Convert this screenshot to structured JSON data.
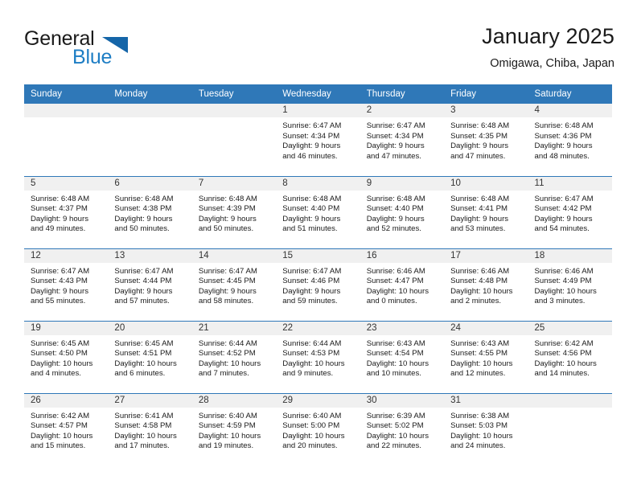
{
  "brand": {
    "name_part1": "General",
    "name_part2": "Blue",
    "logo_icon": "triangle-flag-icon",
    "accent_color": "#1d7dc4",
    "logo_triangle_color": "#1565a8"
  },
  "header": {
    "title": "January 2025",
    "subtitle": "Omigawa, Chiba, Japan"
  },
  "theme": {
    "header_band_color": "#2f78b8",
    "daynum_band_color": "#f0f0f0",
    "row_divider_color": "#2f78b8",
    "page_background": "#ffffff",
    "text_color": "#1a1a1a"
  },
  "weekdays": [
    "Sunday",
    "Monday",
    "Tuesday",
    "Wednesday",
    "Thursday",
    "Friday",
    "Saturday"
  ],
  "weeks": [
    [
      {
        "day": "",
        "empty": true,
        "info": ""
      },
      {
        "day": "",
        "empty": true,
        "info": ""
      },
      {
        "day": "",
        "empty": true,
        "info": ""
      },
      {
        "day": "1",
        "empty": false,
        "info": "Sunrise: 6:47 AM\nSunset: 4:34 PM\nDaylight: 9 hours\nand 46 minutes."
      },
      {
        "day": "2",
        "empty": false,
        "info": "Sunrise: 6:47 AM\nSunset: 4:34 PM\nDaylight: 9 hours\nand 47 minutes."
      },
      {
        "day": "3",
        "empty": false,
        "info": "Sunrise: 6:48 AM\nSunset: 4:35 PM\nDaylight: 9 hours\nand 47 minutes."
      },
      {
        "day": "4",
        "empty": false,
        "info": "Sunrise: 6:48 AM\nSunset: 4:36 PM\nDaylight: 9 hours\nand 48 minutes."
      }
    ],
    [
      {
        "day": "5",
        "empty": false,
        "info": "Sunrise: 6:48 AM\nSunset: 4:37 PM\nDaylight: 9 hours\nand 49 minutes."
      },
      {
        "day": "6",
        "empty": false,
        "info": "Sunrise: 6:48 AM\nSunset: 4:38 PM\nDaylight: 9 hours\nand 50 minutes."
      },
      {
        "day": "7",
        "empty": false,
        "info": "Sunrise: 6:48 AM\nSunset: 4:39 PM\nDaylight: 9 hours\nand 50 minutes."
      },
      {
        "day": "8",
        "empty": false,
        "info": "Sunrise: 6:48 AM\nSunset: 4:40 PM\nDaylight: 9 hours\nand 51 minutes."
      },
      {
        "day": "9",
        "empty": false,
        "info": "Sunrise: 6:48 AM\nSunset: 4:40 PM\nDaylight: 9 hours\nand 52 minutes."
      },
      {
        "day": "10",
        "empty": false,
        "info": "Sunrise: 6:48 AM\nSunset: 4:41 PM\nDaylight: 9 hours\nand 53 minutes."
      },
      {
        "day": "11",
        "empty": false,
        "info": "Sunrise: 6:47 AM\nSunset: 4:42 PM\nDaylight: 9 hours\nand 54 minutes."
      }
    ],
    [
      {
        "day": "12",
        "empty": false,
        "info": "Sunrise: 6:47 AM\nSunset: 4:43 PM\nDaylight: 9 hours\nand 55 minutes."
      },
      {
        "day": "13",
        "empty": false,
        "info": "Sunrise: 6:47 AM\nSunset: 4:44 PM\nDaylight: 9 hours\nand 57 minutes."
      },
      {
        "day": "14",
        "empty": false,
        "info": "Sunrise: 6:47 AM\nSunset: 4:45 PM\nDaylight: 9 hours\nand 58 minutes."
      },
      {
        "day": "15",
        "empty": false,
        "info": "Sunrise: 6:47 AM\nSunset: 4:46 PM\nDaylight: 9 hours\nand 59 minutes."
      },
      {
        "day": "16",
        "empty": false,
        "info": "Sunrise: 6:46 AM\nSunset: 4:47 PM\nDaylight: 10 hours\nand 0 minutes."
      },
      {
        "day": "17",
        "empty": false,
        "info": "Sunrise: 6:46 AM\nSunset: 4:48 PM\nDaylight: 10 hours\nand 2 minutes."
      },
      {
        "day": "18",
        "empty": false,
        "info": "Sunrise: 6:46 AM\nSunset: 4:49 PM\nDaylight: 10 hours\nand 3 minutes."
      }
    ],
    [
      {
        "day": "19",
        "empty": false,
        "info": "Sunrise: 6:45 AM\nSunset: 4:50 PM\nDaylight: 10 hours\nand 4 minutes."
      },
      {
        "day": "20",
        "empty": false,
        "info": "Sunrise: 6:45 AM\nSunset: 4:51 PM\nDaylight: 10 hours\nand 6 minutes."
      },
      {
        "day": "21",
        "empty": false,
        "info": "Sunrise: 6:44 AM\nSunset: 4:52 PM\nDaylight: 10 hours\nand 7 minutes."
      },
      {
        "day": "22",
        "empty": false,
        "info": "Sunrise: 6:44 AM\nSunset: 4:53 PM\nDaylight: 10 hours\nand 9 minutes."
      },
      {
        "day": "23",
        "empty": false,
        "info": "Sunrise: 6:43 AM\nSunset: 4:54 PM\nDaylight: 10 hours\nand 10 minutes."
      },
      {
        "day": "24",
        "empty": false,
        "info": "Sunrise: 6:43 AM\nSunset: 4:55 PM\nDaylight: 10 hours\nand 12 minutes."
      },
      {
        "day": "25",
        "empty": false,
        "info": "Sunrise: 6:42 AM\nSunset: 4:56 PM\nDaylight: 10 hours\nand 14 minutes."
      }
    ],
    [
      {
        "day": "26",
        "empty": false,
        "info": "Sunrise: 6:42 AM\nSunset: 4:57 PM\nDaylight: 10 hours\nand 15 minutes."
      },
      {
        "day": "27",
        "empty": false,
        "info": "Sunrise: 6:41 AM\nSunset: 4:58 PM\nDaylight: 10 hours\nand 17 minutes."
      },
      {
        "day": "28",
        "empty": false,
        "info": "Sunrise: 6:40 AM\nSunset: 4:59 PM\nDaylight: 10 hours\nand 19 minutes."
      },
      {
        "day": "29",
        "empty": false,
        "info": "Sunrise: 6:40 AM\nSunset: 5:00 PM\nDaylight: 10 hours\nand 20 minutes."
      },
      {
        "day": "30",
        "empty": false,
        "info": "Sunrise: 6:39 AM\nSunset: 5:02 PM\nDaylight: 10 hours\nand 22 minutes."
      },
      {
        "day": "31",
        "empty": false,
        "info": "Sunrise: 6:38 AM\nSunset: 5:03 PM\nDaylight: 10 hours\nand 24 minutes."
      },
      {
        "day": "",
        "empty": true,
        "info": ""
      }
    ]
  ]
}
